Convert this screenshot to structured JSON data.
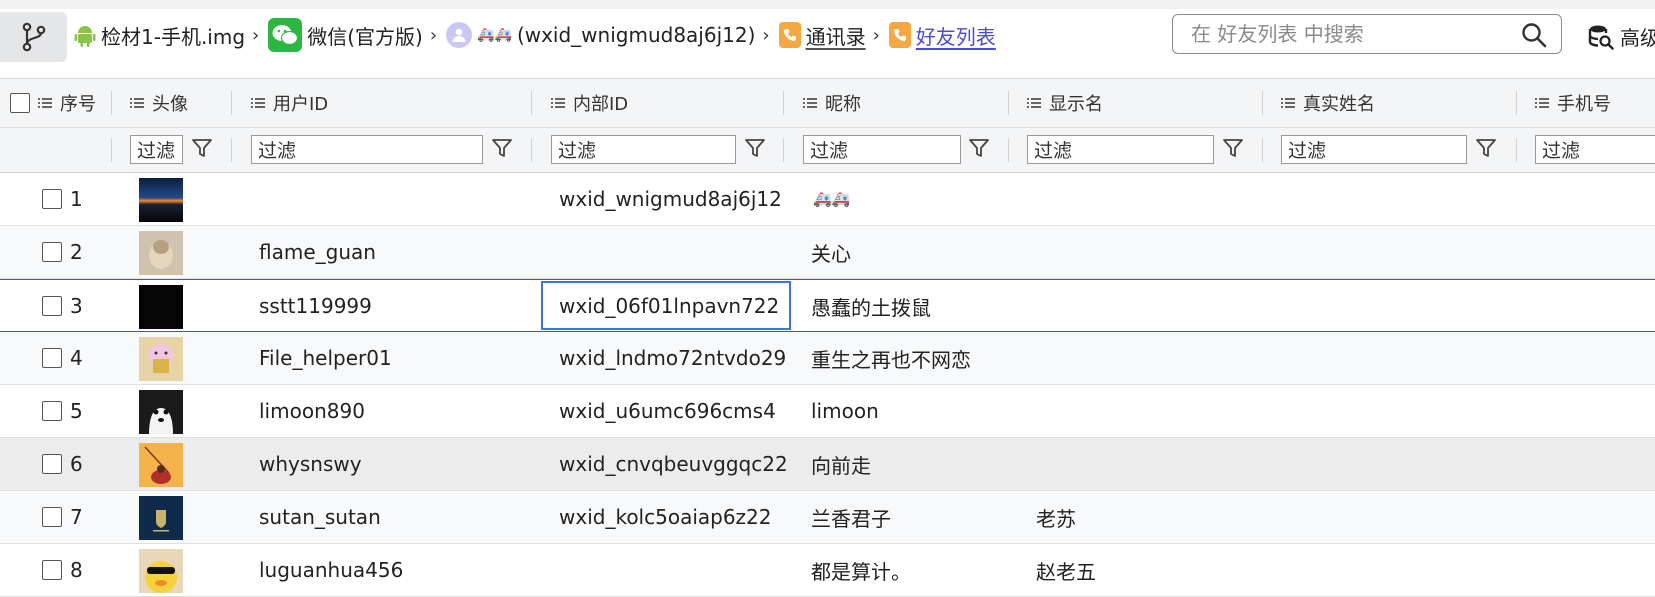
{
  "breadcrumb": [
    {
      "label": "检材1-手机.img",
      "icon": "android-icon"
    },
    {
      "label": "微信(官方版)",
      "icon": "wechat-icon"
    },
    {
      "label": "(wxid_wnigmud8aj6j12)",
      "icon": "user-avatar-icon",
      "emoji": "🚑🚑"
    },
    {
      "label": "通讯录",
      "icon": "contacts-icon"
    },
    {
      "label": "好友列表",
      "icon": "contacts-icon"
    }
  ],
  "search": {
    "placeholder": "在 好友列表 中搜索"
  },
  "advanced_label": "高级",
  "columns": [
    "序号",
    "头像",
    "用户ID",
    "内部ID",
    "昵称",
    "显示名",
    "真实姓名",
    "手机号"
  ],
  "filter_placeholder": "过滤",
  "rows": [
    {
      "no": "1",
      "user_id": "",
      "internal_id": "wxid_wnigmud8aj6j12",
      "nickname": "🚑🚑",
      "display_name": "",
      "real_name": "",
      "phone": ""
    },
    {
      "no": "2",
      "user_id": "flame_guan",
      "internal_id": "",
      "nickname": "关心",
      "display_name": "",
      "real_name": "",
      "phone": ""
    },
    {
      "no": "3",
      "user_id": "sstt119999",
      "internal_id": "wxid_06f01lnpavn722",
      "nickname": "愚蠢的土拨鼠",
      "display_name": "",
      "real_name": "",
      "phone": ""
    },
    {
      "no": "4",
      "user_id": "File_helper01",
      "internal_id": "wxid_lndmo72ntvdo29",
      "nickname": "重生之再也不网恋",
      "display_name": "",
      "real_name": "",
      "phone": ""
    },
    {
      "no": "5",
      "user_id": "limoon890",
      "internal_id": "wxid_u6umc696cms4...",
      "nickname": "limoon",
      "display_name": "",
      "real_name": "",
      "phone": ""
    },
    {
      "no": "6",
      "user_id": "whysnswy",
      "internal_id": "wxid_cnvqbeuvggqc22",
      "nickname": "向前走",
      "display_name": "",
      "real_name": "",
      "phone": ""
    },
    {
      "no": "7",
      "user_id": "sutan_sutan",
      "internal_id": "wxid_kolc5oaiap6z22",
      "nickname": "兰香君子",
      "display_name": "老苏",
      "real_name": "",
      "phone": ""
    },
    {
      "no": "8",
      "user_id": "luguanhua456",
      "internal_id": "",
      "nickname": "都是算计。",
      "display_name": "赵老五",
      "real_name": "",
      "phone": ""
    }
  ],
  "colors": {
    "accent": "#4a4adf",
    "focus": "#3c78d8",
    "wechat": "#2cb742",
    "android": "#8bc34a"
  }
}
